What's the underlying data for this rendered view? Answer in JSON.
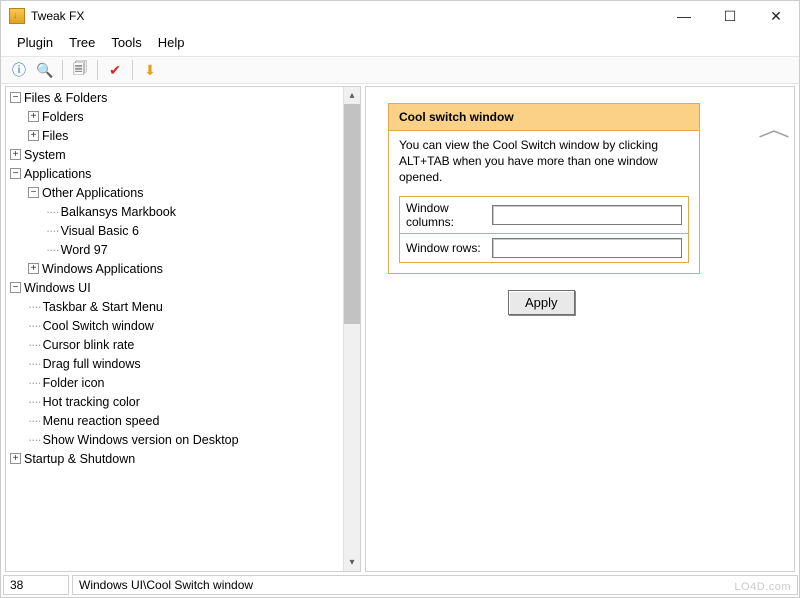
{
  "window": {
    "title": "Tweak FX"
  },
  "menu": {
    "items": [
      "Plugin",
      "Tree",
      "Tools",
      "Help"
    ]
  },
  "toolbar": {
    "buttons": [
      {
        "name": "info-icon",
        "glyph": "ⓘ"
      },
      {
        "name": "search-icon",
        "glyph": "🔍"
      },
      {
        "sep": true
      },
      {
        "name": "find-page-icon",
        "glyph": "🗐"
      },
      {
        "sep": true
      },
      {
        "name": "check-page-icon",
        "glyph": "✔"
      },
      {
        "sep": true
      },
      {
        "name": "download-icon",
        "glyph": "⬇"
      }
    ]
  },
  "tree": [
    {
      "exp": "-",
      "label": "Files & Folders",
      "lvl": 0
    },
    {
      "exp": "+",
      "label": "Folders",
      "lvl": 1
    },
    {
      "exp": "+",
      "label": "Files",
      "lvl": 1
    },
    {
      "exp": "+",
      "label": "System",
      "lvl": 0
    },
    {
      "exp": "-",
      "label": "Applications",
      "lvl": 0
    },
    {
      "exp": "-",
      "label": "Other Applications",
      "lvl": 1
    },
    {
      "exp": "",
      "label": "Balkansys Markbook",
      "lvl": 2
    },
    {
      "exp": "",
      "label": "Visual Basic 6",
      "lvl": 2
    },
    {
      "exp": "",
      "label": "Word 97",
      "lvl": 2
    },
    {
      "exp": "+",
      "label": "Windows Applications",
      "lvl": 1
    },
    {
      "exp": "-",
      "label": "Windows UI",
      "lvl": 0
    },
    {
      "exp": "",
      "label": "Taskbar & Start Menu",
      "lvl": 1
    },
    {
      "exp": "",
      "label": "Cool Switch window",
      "lvl": 1
    },
    {
      "exp": "",
      "label": "Cursor blink rate",
      "lvl": 1
    },
    {
      "exp": "",
      "label": "Drag full windows",
      "lvl": 1
    },
    {
      "exp": "",
      "label": "Folder icon",
      "lvl": 1
    },
    {
      "exp": "",
      "label": "Hot tracking color",
      "lvl": 1
    },
    {
      "exp": "",
      "label": "Menu reaction speed",
      "lvl": 1
    },
    {
      "exp": "",
      "label": "Show Windows version on Desktop",
      "lvl": 1
    },
    {
      "exp": "+",
      "label": "Startup & Shutdown",
      "lvl": 0
    }
  ],
  "panel": {
    "title": "Cool switch window",
    "desc": "You can view the Cool Switch window by clicking ALT+TAB when you have more than one window opened.",
    "field1_label": "Window columns:",
    "field2_label": "Window rows:",
    "apply": "Apply"
  },
  "status": {
    "count": "38",
    "path": "Windows UI\\Cool Switch window"
  },
  "watermark": "LO4D.com"
}
